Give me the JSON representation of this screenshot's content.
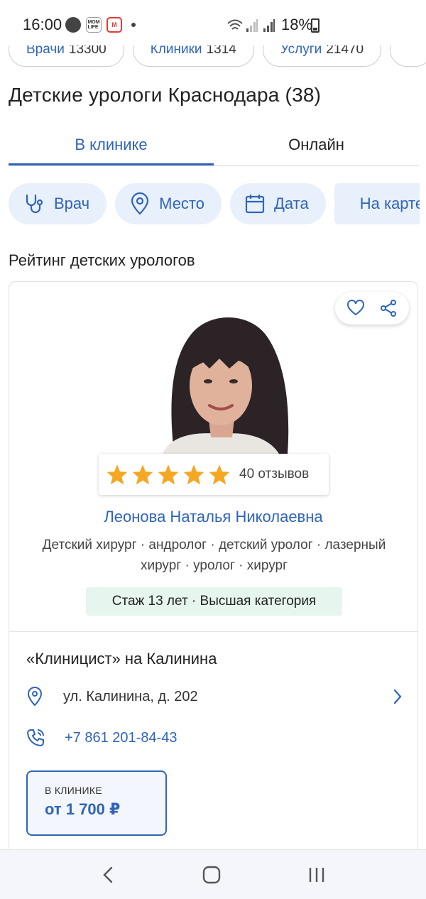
{
  "status_bar": {
    "time": "16:00",
    "battery": "18%"
  },
  "counts": [
    {
      "label": "Врачи",
      "count": "13300"
    },
    {
      "label": "Клиники",
      "count": "1314"
    },
    {
      "label": "Услуги",
      "count": "21470"
    }
  ],
  "page_title": "Детские урологи Краснодара (38)",
  "tabs": [
    {
      "label": "В клинике",
      "active": true
    },
    {
      "label": "Онлайн",
      "active": false
    }
  ],
  "filters": [
    {
      "label": "Врач",
      "icon": "stethoscope-icon"
    },
    {
      "label": "Место",
      "icon": "location-pin-icon"
    },
    {
      "label": "Дата",
      "icon": "calendar-icon"
    },
    {
      "label": "На карте",
      "icon": ""
    }
  ],
  "rating_heading": "Рейтинг детских урологов",
  "doctor": {
    "reviews": "40 отзывов",
    "stars": 5,
    "name": "Леонова Наталья Николаевна",
    "specialties": "Детский хирург · андролог · детский уролог · лазерный хирург · уролог · хирург",
    "badge": "Стаж 13 лет · Высшая категория",
    "clinic": "«Клиницист» на Калинина",
    "address": "ул. Калинина, д. 202",
    "phone": "+7 861 201-84-43",
    "price_label": "В КЛИНИКЕ",
    "price": "от 1 700 ₽"
  },
  "colors": {
    "accent": "#2f64b9",
    "chip_bg": "#e8f0fb",
    "star": "#f5a623",
    "badge_bg": "#e6f5ee"
  }
}
